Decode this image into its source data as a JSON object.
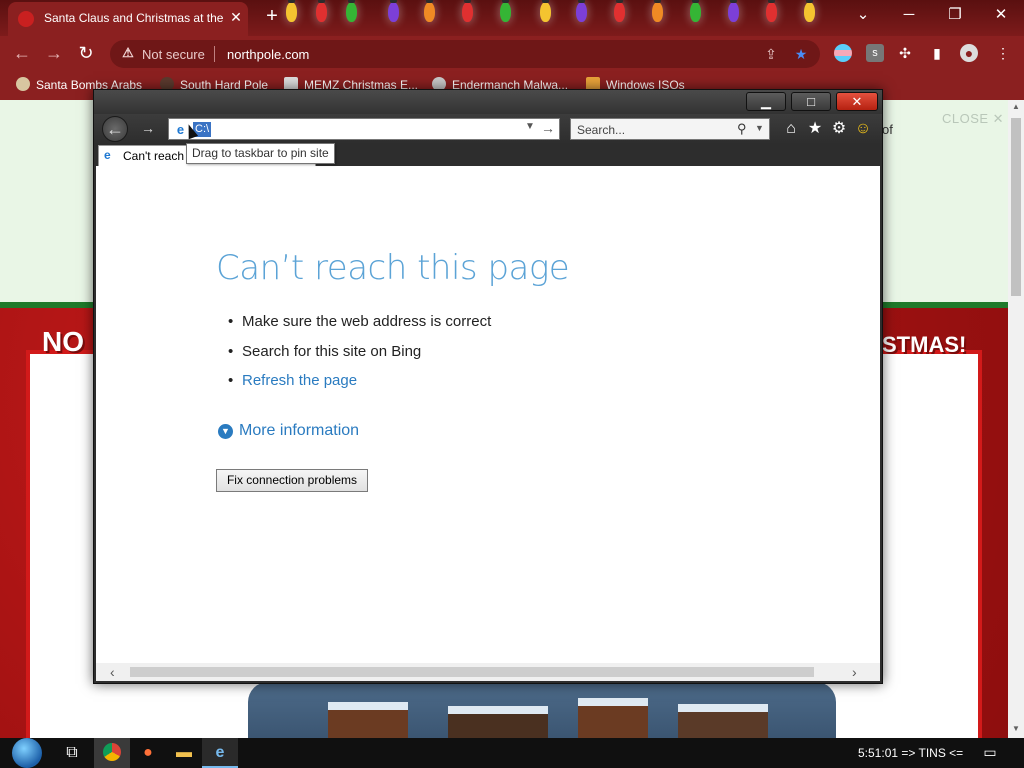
{
  "browser": {
    "tab_title": "Santa Claus and Christmas at the",
    "tab_close": "✕",
    "new_tab": "+",
    "window_minimize": "─",
    "window_restore": "❐",
    "window_close": "✕",
    "tab_search": "⌄",
    "security_label": "Not secure",
    "url": "northpole.com",
    "bookmarks": [
      {
        "label": "Santa Bombs Arabs"
      },
      {
        "label": "South Hard Pole"
      },
      {
        "label": "MEMZ Christmas E..."
      },
      {
        "label": "Endermanch Malwa..."
      },
      {
        "label": "Windows ISOs"
      }
    ]
  },
  "background_page": {
    "close_label": "CLOSE ✕",
    "side_text": "of",
    "banner_left": "NO",
    "banner_right": "STMAS!"
  },
  "ie": {
    "address_value": "C:\\",
    "search_placeholder": "Search...",
    "tab_title": "Can't reach",
    "tooltip": "Drag to taskbar to pin site",
    "error_title": "Can’t reach this page",
    "suggestions": [
      "Make sure the web address is correct",
      "Search for this site on Bing",
      "Refresh the page"
    ],
    "more_information": "More information",
    "fix_button": "Fix connection problems"
  },
  "taskbar": {
    "clock": "5:51:01 => TINS <="
  },
  "colors": {
    "chrome_bar": "#8b2020",
    "ie_error_title": "#5ba3d6",
    "ie_link": "#2a7bc0",
    "background_red": "#b51515",
    "background_green": "#1f7a2a"
  }
}
